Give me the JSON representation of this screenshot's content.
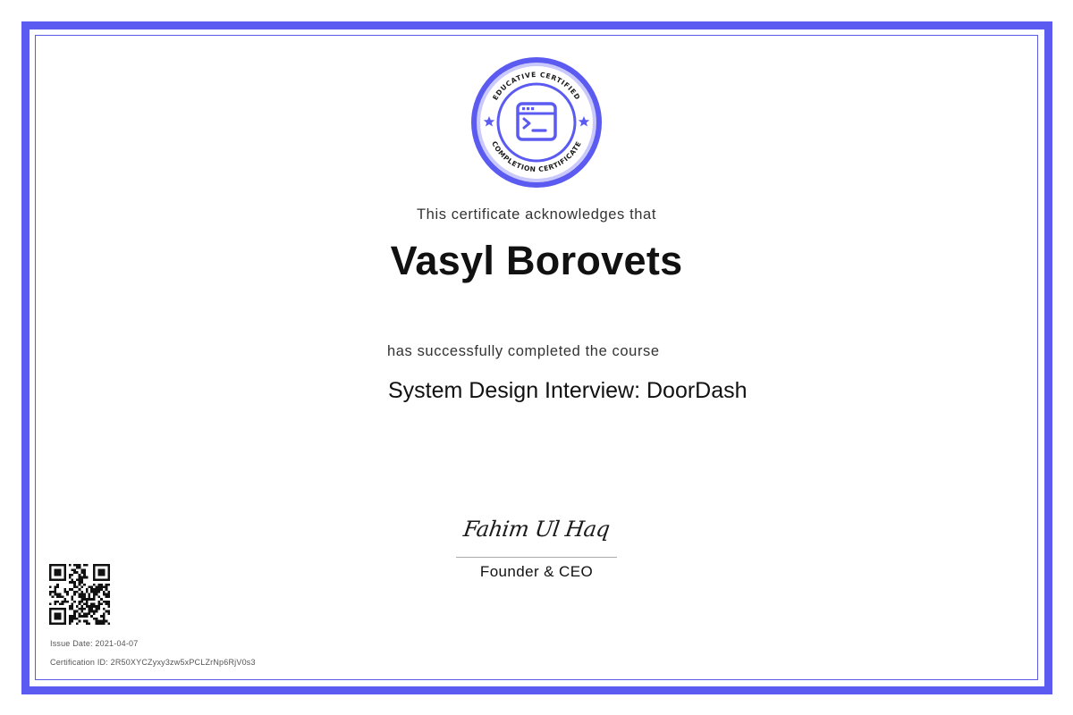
{
  "seal": {
    "top_text": "EDUCATIVE CERTIFIED",
    "bottom_text": "COMPLETION CERTIFICATE",
    "icon": "terminal-window-icon",
    "star_icon": "star-icon"
  },
  "certificate": {
    "acknowledges_text": "This certificate acknowledges that",
    "recipient_name": "Vasyl Borovets",
    "completed_text": "has successfully completed the course",
    "course_title": "System Design Interview: DoorDash"
  },
  "signatory": {
    "signature": "Fahim Ul Haq",
    "role": "Founder & CEO"
  },
  "meta": {
    "issue_date": "Issue Date: 2021-04-07",
    "certification_id": "Certification ID: 2R50XYCZyxy3zw5xPCLZrNp6RjV0s3"
  },
  "qr_icon": "qr-code-icon",
  "colors": {
    "frame": "#5b5bf1",
    "seal_accent": "#5b5bf1",
    "seal_light": "#c9c9fb",
    "text": "#111111"
  }
}
